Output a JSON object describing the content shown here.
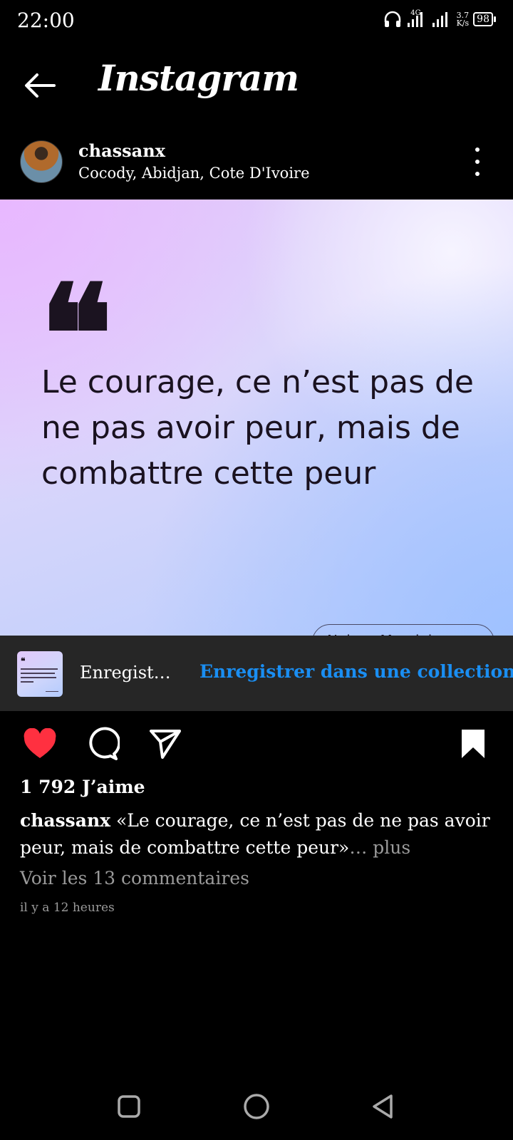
{
  "status_bar": {
    "time": "22:00",
    "network_type": "4G",
    "speed_value": "3.7",
    "speed_unit": "K/s",
    "battery": "98"
  },
  "header": {
    "title": "Instagram"
  },
  "post": {
    "username": "chassanx",
    "location": "Cocody, Abidjan, Cote D'Ivoire",
    "image_quote_mark": "❝",
    "image_quote": "Le courage, ce n’est pas de ne pas avoir peur, mais de combattre cette peur",
    "image_author": "Nelson Mandela"
  },
  "save_toast": {
    "label": "Enregist…",
    "action": "Enregistrer dans une collection"
  },
  "actions": {
    "liked": true,
    "saved": true,
    "like_color": "#ff3040"
  },
  "meta": {
    "likes": "1 792 J’aime",
    "caption_user": "chassanx",
    "caption_text": " «Le courage, ce n’est pas de ne pas avoir peur, mais de combattre cette peur»",
    "caption_more": "… plus",
    "comments_link": "Voir les 13 commentaires",
    "time_ago": "il y a 12 heures"
  }
}
